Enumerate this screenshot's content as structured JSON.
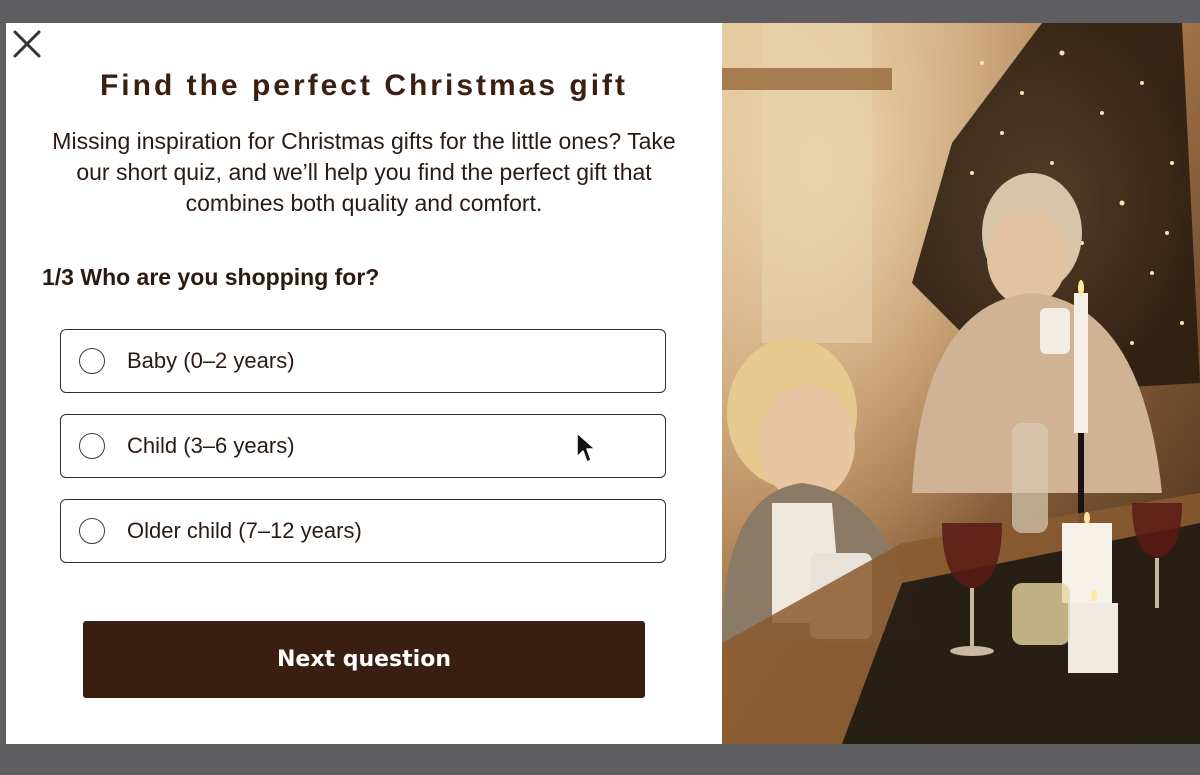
{
  "modal": {
    "title": "Find the perfect Christmas gift",
    "intro": "Missing inspiration for Christmas gifts for the little ones? Take our short quiz, and we’ll help you find the perfect gift that combines both quality and comfort.",
    "question": "1/3 Who are you shopping for?",
    "options": [
      {
        "label": "Baby (0–2 years)"
      },
      {
        "label": "Child (3–6 years)"
      },
      {
        "label": "Older child (7–12 years)"
      }
    ],
    "next_label": "Next question",
    "close_icon": "close-icon"
  },
  "photo": {
    "description_icon": "christmas-family-photo"
  },
  "colors": {
    "brand_dark": "#3b1e12",
    "overlay": "#5e5e60"
  }
}
